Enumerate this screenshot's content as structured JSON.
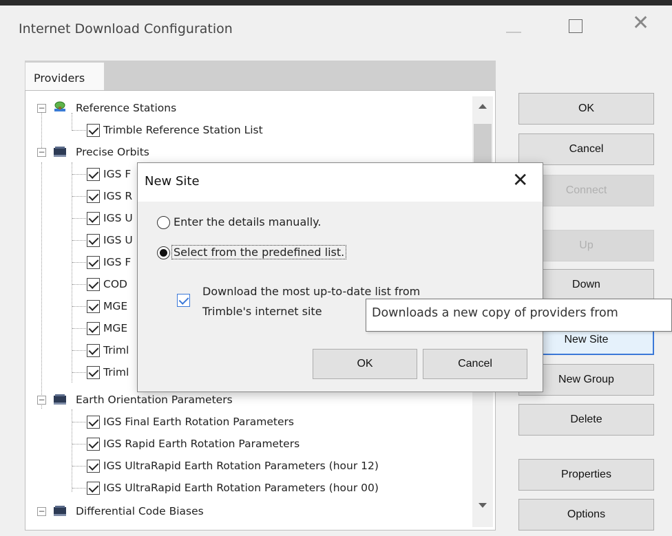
{
  "window": {
    "title": "Internet Download Configuration"
  },
  "tabs": [
    {
      "label": "Providers"
    }
  ],
  "tree": {
    "categories": [
      {
        "label": "Reference Stations",
        "icon": "reference-station-icon",
        "items": [
          "Trimble Reference Station List"
        ]
      },
      {
        "label": "Precise Orbits",
        "icon": "orbit-icon",
        "items": [
          "IGS F",
          "IGS R",
          "IGS U",
          "IGS U",
          "IGS F",
          "COD",
          "MGE",
          "MGE",
          "Triml",
          "Triml"
        ]
      },
      {
        "label": "Earth Orientation Parameters",
        "icon": "earth-orientation-icon",
        "items": [
          "IGS Final Earth Rotation Parameters",
          "IGS Rapid Earth Rotation Parameters",
          "IGS UltraRapid Earth Rotation Parameters (hour 12)",
          "IGS UltraRapid Earth Rotation Parameters (hour 00)"
        ]
      },
      {
        "label": "Differential Code Biases",
        "icon": "code-biases-icon",
        "items": []
      }
    ]
  },
  "side_buttons": {
    "ok": "OK",
    "cancel": "Cancel",
    "connect": "Connect",
    "up": "Up",
    "down": "Down",
    "new_site": "New Site",
    "new_group": "New Group",
    "delete": "Delete",
    "properties": "Properties",
    "options": "Options"
  },
  "dialog": {
    "title": "New Site",
    "radio_manual": "Enter the details manually.",
    "radio_predefined": "Select from the predefined list.",
    "download_line1": "Download the most up-to-date list from",
    "download_line2": "Trimble's internet site",
    "ok": "OK",
    "cancel": "Cancel"
  },
  "tooltip": {
    "text": "Downloads a new copy of providers from"
  }
}
